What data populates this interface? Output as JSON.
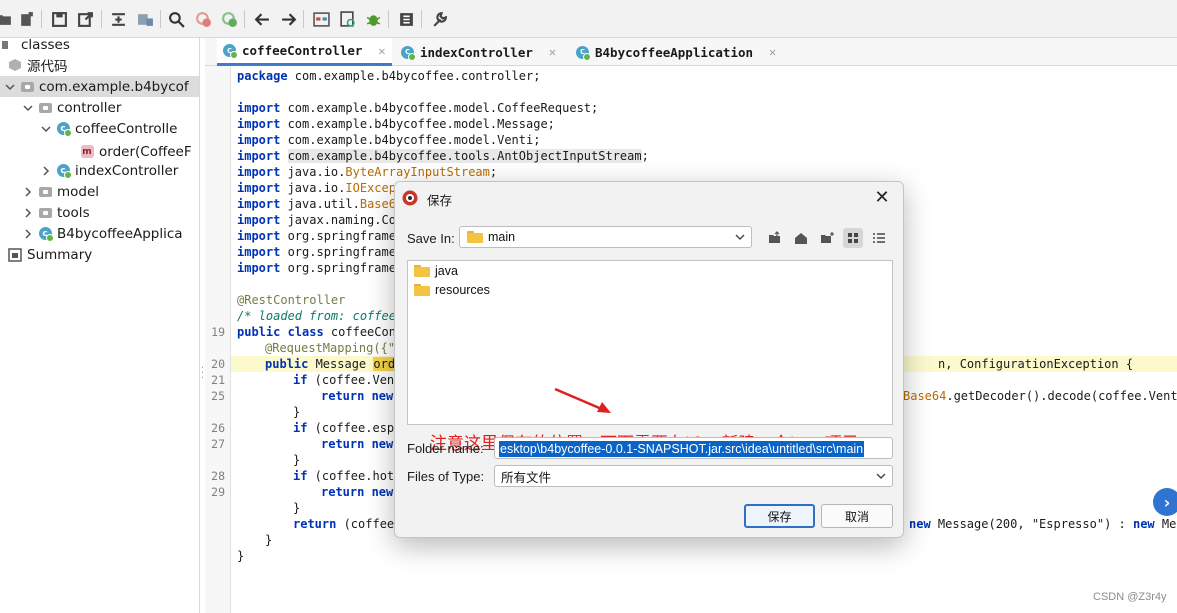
{
  "tree": {
    "root_label": "classes",
    "source_label": "源代码",
    "package_label": "com.example.b4bycof",
    "controller_label": "controller",
    "coffee_controller_label": "coffeeControlle",
    "order_method_label": "order(CoffeeF",
    "index_controller_label": "indexController",
    "model_label": "model",
    "tools_label": "tools",
    "app_label": "B4bycoffeeApplica",
    "summary_label": "Summary"
  },
  "tabs": [
    {
      "label": "coffeeController"
    },
    {
      "label": "indexController"
    },
    {
      "label": "B4bycoffeeApplication"
    }
  ],
  "line_numbers": [
    "19",
    "20",
    "21",
    "25",
    "26",
    "27",
    "28",
    "29"
  ],
  "code": {
    "l1_kw": "package",
    "l1_rest": " com.example.b4bycoffee.controller;",
    "imports": [
      {
        "kw": "import",
        "pre": " com.example.b4bycoffee.model.CoffeeRequest;",
        "cls": "",
        "post": ""
      },
      {
        "kw": "import",
        "pre": " com.example.b4bycoffee.model.Message;",
        "cls": "",
        "post": ""
      },
      {
        "kw": "import",
        "pre": " com.example.b4bycoffee.model.Venti;",
        "cls": "",
        "post": ""
      },
      {
        "kw": "import",
        "pre": " ",
        "cls": "",
        "hl": "com.example.b4bycoffee.tools.AntObjectInputStream",
        "post": ";"
      },
      {
        "kw": "import",
        "pre": " java.io.",
        "cls": "ByteArrayInputStream",
        "post": ";"
      },
      {
        "kw": "import",
        "pre": " java.io.",
        "cls": "IOExcep",
        "post": ""
      },
      {
        "kw": "import",
        "pre": " java.util.",
        "cls": "Base64",
        "post": ""
      },
      {
        "kw": "import",
        "pre": " javax.naming.Co",
        "cls": "",
        "post": ""
      },
      {
        "kw": "import",
        "pre": " org.springframew",
        "cls": "",
        "post": ""
      },
      {
        "kw": "import",
        "pre": " org.springframew",
        "cls": "",
        "post": ""
      },
      {
        "kw": "import",
        "pre": " org.springframew",
        "cls": "",
        "post": ""
      }
    ],
    "rest_controller": "@RestController",
    "loaded_comment": "/* loaded from: coffee",
    "class_decl_kw": "public class",
    "class_decl_rest": " coffeeCont",
    "request_mapping": "@RequestMapping({\"/",
    "method_kw": "public",
    "method_type": " Message ",
    "method_name": "orde",
    "method_tail_pre": "n, ",
    "method_tail": "ConfigurationException {",
    "if1_kw": "if",
    "if1_rest": " (coffee.Vent",
    "ret1_kw": "return",
    "ret1_new": " new",
    "ret1_tail_cls": "Base64",
    "ret1_tail": ".getDecoder().decode(coffee.Venti",
    "brace_close": "}",
    "if2_kw": "if",
    "if2_rest": " (coffee.espr",
    "ret2_kw": "return",
    "ret2_new": " new",
    "if3_kw": "if",
    "if3_rest": " (coffee.hotW",
    "ret3_kw": "return",
    "ret3_new": " new",
    "ret4_kw": "return",
    "ret4_rest": " (coffee",
    "ret4_tail_new": "new",
    "ret4_tail": " Message(200, \"Espresso\") : ",
    "ret4_tail_new2": "new",
    "ret4_tail_end": " Mes"
  },
  "dialog": {
    "title": "保存",
    "save_in_label": "Save In:",
    "save_in_value": "main",
    "files": [
      "java",
      "resources"
    ],
    "annotation": "注意这里保存的位置，下面需要在idea新建一个java项目",
    "folder_name_label": "Folder name:",
    "folder_name_value": "esktop\\b4bycoffee-0.0.1-SNAPSHOT.jar.src\\idea\\untitled\\src\\main",
    "files_of_type_label": "Files of Type:",
    "files_of_type_value": "所有文件",
    "save_button": "保存",
    "cancel_button": "取消"
  },
  "watermark": "CSDN @Z3r4y",
  "colors": {
    "accent": "#3e7cc9",
    "annotation": "#e02020",
    "selection": "#0a64c8"
  }
}
